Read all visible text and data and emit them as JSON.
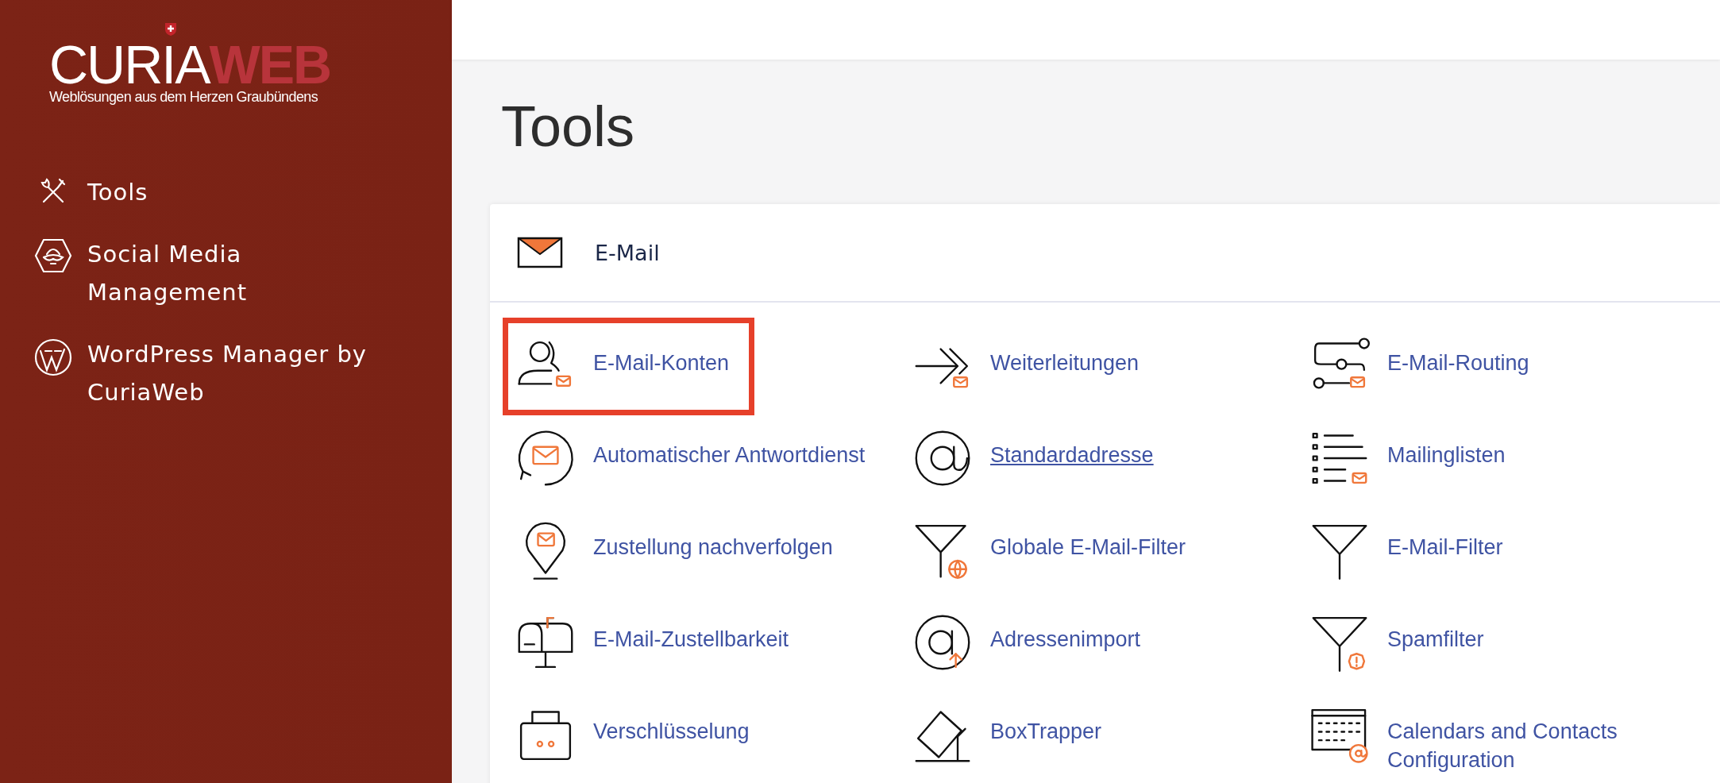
{
  "logo": {
    "name_light": "CURIA",
    "name_bold": "WEB",
    "tagline": "Weblösungen aus dem Herzen Graubündens"
  },
  "sidebar": {
    "items": [
      {
        "lines": [
          "Tools"
        ]
      },
      {
        "lines": [
          "Social Media",
          "Management"
        ]
      },
      {
        "lines": [
          "WordPress Manager by",
          "CuriaWeb"
        ]
      }
    ]
  },
  "page": {
    "title": "Tools"
  },
  "section": {
    "title": "E-Mail"
  },
  "tools": [
    {
      "label": "E-Mail-Konten",
      "highlighted": true,
      "hovered": false
    },
    {
      "label": "Weiterleitungen",
      "highlighted": false,
      "hovered": false
    },
    {
      "label": "E-Mail-Routing",
      "highlighted": false,
      "hovered": false
    },
    {
      "label": "Automatischer Antwortdienst",
      "highlighted": false,
      "hovered": false
    },
    {
      "label": "Standardadresse",
      "highlighted": false,
      "hovered": true
    },
    {
      "label": "Mailinglisten",
      "highlighted": false,
      "hovered": false
    },
    {
      "label": "Zustellung nachverfolgen",
      "highlighted": false,
      "hovered": false
    },
    {
      "label": "Globale E-Mail-Filter",
      "highlighted": false,
      "hovered": false
    },
    {
      "label": "E-Mail-Filter",
      "highlighted": false,
      "hovered": false
    },
    {
      "label": "E-Mail-Zustellbarkeit",
      "highlighted": false,
      "hovered": false
    },
    {
      "label": "Adressenimport",
      "highlighted": false,
      "hovered": false
    },
    {
      "label": "Spamfilter",
      "highlighted": false,
      "hovered": false
    },
    {
      "label": "Verschlüsselung",
      "highlighted": false,
      "hovered": false
    },
    {
      "label": "BoxTrapper",
      "highlighted": false,
      "hovered": false
    },
    {
      "label": "Calendars and Contacts Configuration",
      "highlighted": false,
      "hovered": false
    }
  ]
}
